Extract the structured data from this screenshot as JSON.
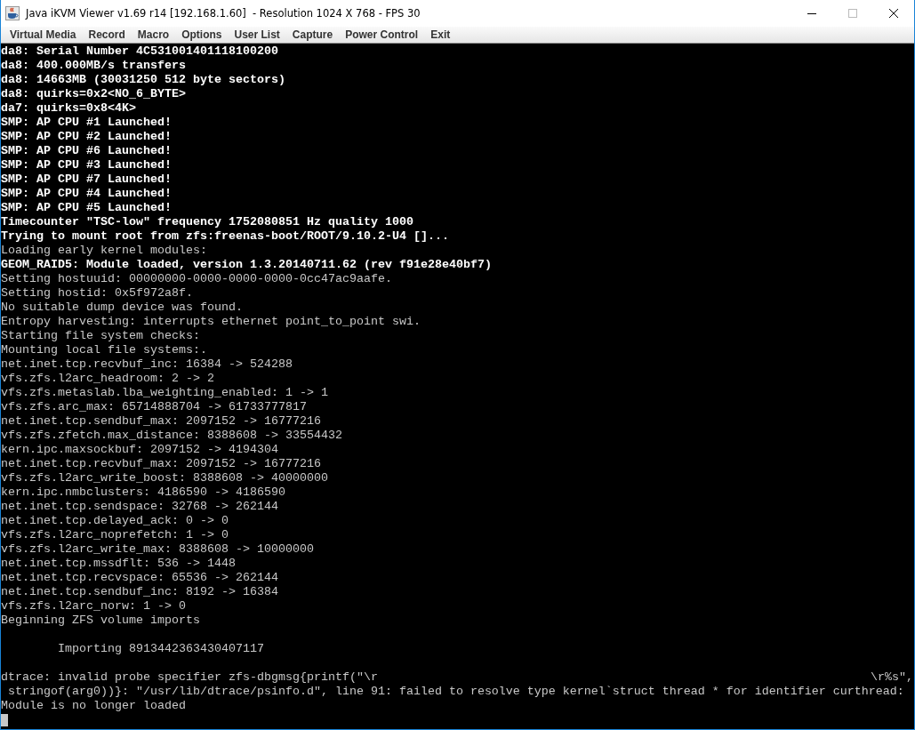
{
  "window": {
    "title": "Java iKVM Viewer v1.69 r14 [192.168.1.60]  - Resolution 1024 X 768 - FPS 30"
  },
  "menu": [
    "Virtual Media",
    "Record",
    "Macro",
    "Options",
    "User List",
    "Capture",
    "Power Control",
    "Exit"
  ],
  "console": {
    "lines": [
      {
        "text": "da8: Serial Number 4C531001401118100200",
        "bright": true
      },
      {
        "text": "da8: 400.000MB/s transfers",
        "bright": true
      },
      {
        "text": "da8: 14663MB (30031250 512 byte sectors)",
        "bright": true
      },
      {
        "text": "da8: quirks=0x2<NO_6_BYTE>",
        "bright": true
      },
      {
        "text": "da7: quirks=0x8<4K>",
        "bright": true
      },
      {
        "text": "SMP: AP CPU #1 Launched!",
        "bright": true
      },
      {
        "text": "SMP: AP CPU #2 Launched!",
        "bright": true
      },
      {
        "text": "SMP: AP CPU #6 Launched!",
        "bright": true
      },
      {
        "text": "SMP: AP CPU #3 Launched!",
        "bright": true
      },
      {
        "text": "SMP: AP CPU #7 Launched!",
        "bright": true
      },
      {
        "text": "SMP: AP CPU #4 Launched!",
        "bright": true
      },
      {
        "text": "SMP: AP CPU #5 Launched!",
        "bright": true
      },
      {
        "text": "Timecounter \"TSC-low\" frequency 1752080851 Hz quality 1000",
        "bright": true
      },
      {
        "text": "Trying to mount root from zfs:freenas-boot/ROOT/9.10.2-U4 []...",
        "bright": true
      },
      {
        "text": "Loading early kernel modules:",
        "bright": false
      },
      {
        "text": "GEOM_RAID5: Module loaded, version 1.3.20140711.62 (rev f91e28e40bf7)",
        "bright": true
      },
      {
        "text": "Setting hostuuid: 00000000-0000-0000-0000-0cc47ac9aafe.",
        "bright": false
      },
      {
        "text": "Setting hostid: 0x5f972a8f.",
        "bright": false
      },
      {
        "text": "No suitable dump device was found.",
        "bright": false
      },
      {
        "text": "Entropy harvesting: interrupts ethernet point_to_point swi.",
        "bright": false
      },
      {
        "text": "Starting file system checks:",
        "bright": false
      },
      {
        "text": "Mounting local file systems:.",
        "bright": false
      },
      {
        "text": "net.inet.tcp.recvbuf_inc: 16384 -> 524288",
        "bright": false
      },
      {
        "text": "vfs.zfs.l2arc_headroom: 2 -> 2",
        "bright": false
      },
      {
        "text": "vfs.zfs.metaslab.lba_weighting_enabled: 1 -> 1",
        "bright": false
      },
      {
        "text": "vfs.zfs.arc_max: 65714888704 -> 61733777817",
        "bright": false
      },
      {
        "text": "net.inet.tcp.sendbuf_max: 2097152 -> 16777216",
        "bright": false
      },
      {
        "text": "vfs.zfs.zfetch.max_distance: 8388608 -> 33554432",
        "bright": false
      },
      {
        "text": "kern.ipc.maxsockbuf: 2097152 -> 4194304",
        "bright": false
      },
      {
        "text": "net.inet.tcp.recvbuf_max: 2097152 -> 16777216",
        "bright": false
      },
      {
        "text": "vfs.zfs.l2arc_write_boost: 8388608 -> 40000000",
        "bright": false
      },
      {
        "text": "kern.ipc.nmbclusters: 4186590 -> 4186590",
        "bright": false
      },
      {
        "text": "net.inet.tcp.sendspace: 32768 -> 262144",
        "bright": false
      },
      {
        "text": "net.inet.tcp.delayed_ack: 0 -> 0",
        "bright": false
      },
      {
        "text": "vfs.zfs.l2arc_noprefetch: 1 -> 0",
        "bright": false
      },
      {
        "text": "vfs.zfs.l2arc_write_max: 8388608 -> 10000000",
        "bright": false
      },
      {
        "text": "net.inet.tcp.mssdflt: 536 -> 1448",
        "bright": false
      },
      {
        "text": "net.inet.tcp.recvspace: 65536 -> 262144",
        "bright": false
      },
      {
        "text": "net.inet.tcp.sendbuf_inc: 8192 -> 16384",
        "bright": false
      },
      {
        "text": "vfs.zfs.l2arc_norw: 1 -> 0",
        "bright": false
      },
      {
        "text": "Beginning ZFS volume imports",
        "bright": false
      },
      {
        "text": "Importing 8913442363430407117",
        "bright": false,
        "blank_before": true,
        "indented": true
      },
      {
        "text": "dtrace: invalid probe specifier zfs-dbgmsg{printf(\"\\r",
        "tail": "\\r%s\",",
        "bright": false,
        "blank_before": true
      },
      {
        "text": " stringof(arg0))}: \"/usr/lib/dtrace/psinfo.d\", line 91: failed to resolve type kernel`struct thread * for identifier curthread:",
        "bright": false
      },
      {
        "text": "Module is no longer loaded",
        "bright": false
      }
    ]
  }
}
